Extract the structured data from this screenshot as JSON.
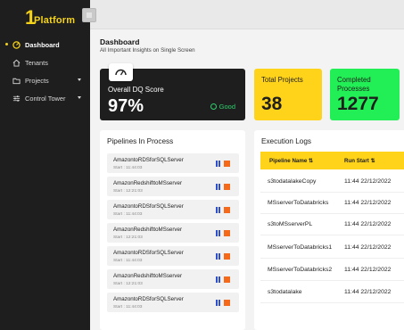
{
  "brand": {
    "logo_mark": "1",
    "name": "Platform"
  },
  "sidebar": {
    "items": [
      {
        "label": "Dashboard",
        "icon": "dashboard-icon",
        "active": true
      },
      {
        "label": "Tenants",
        "icon": "home-icon"
      },
      {
        "label": "Projects",
        "icon": "folder-icon",
        "caret": true
      },
      {
        "label": "Control Tower",
        "icon": "sliders-icon",
        "caret": true
      }
    ]
  },
  "header": {
    "title": "Dashboard",
    "subtitle": "All Important Insights on Single Screen"
  },
  "kpis": {
    "dq": {
      "label": "Overall DQ Score",
      "value": "97%",
      "status": "Good",
      "icon": "gauge-icon"
    },
    "projects": {
      "label": "Total Projects",
      "value": "38"
    },
    "processes": {
      "label": "Completed Processes",
      "value": "1277"
    }
  },
  "pipelines": {
    "title": "Pipelines In Process",
    "rows": [
      {
        "name": "AmazontoRDSforSQLServer",
        "start": "Start : 11:44:03"
      },
      {
        "name": "AmazonRedshifttoMSserver",
        "start": "Start : 12:21:03"
      },
      {
        "name": "AmazontoRDSforSQLServer",
        "start": "Start : 11:44:03"
      },
      {
        "name": "AmazonRedshifttoMSserver",
        "start": "Start : 12:21:03"
      },
      {
        "name": "AmazontoRDSforSQLServer",
        "start": "Start : 11:44:03"
      },
      {
        "name": "AmazonRedshifttoMSserver",
        "start": "Start : 12:21:03"
      },
      {
        "name": "AmazontoRDSforSQLServer",
        "start": "Start : 11:44:03"
      }
    ]
  },
  "logs": {
    "title": "Execution Logs",
    "columns": [
      "Pipeline Name",
      "Run Start"
    ],
    "rows": [
      {
        "name": "s3todatalakeCopy",
        "run": "11:44 22/12/2022"
      },
      {
        "name": "MSserverToDatabricks",
        "run": "11:44 22/12/2022"
      },
      {
        "name": "s3toMSserverPL",
        "run": "11:44 22/12/2022"
      },
      {
        "name": "MSserverToDatabricks1",
        "run": "11:44 22/12/2022"
      },
      {
        "name": "MSserverToDatabricks2",
        "run": "11:44 22/12/2022"
      },
      {
        "name": "s3todatalake",
        "run": "11:44 22/12/2022"
      }
    ]
  },
  "colors": {
    "accent_yellow": "#ffd31a",
    "accent_green": "#22ef55",
    "sidebar_bg": "#1e1e1e",
    "stop": "#f56a1a",
    "pause": "#2e4fc9"
  }
}
